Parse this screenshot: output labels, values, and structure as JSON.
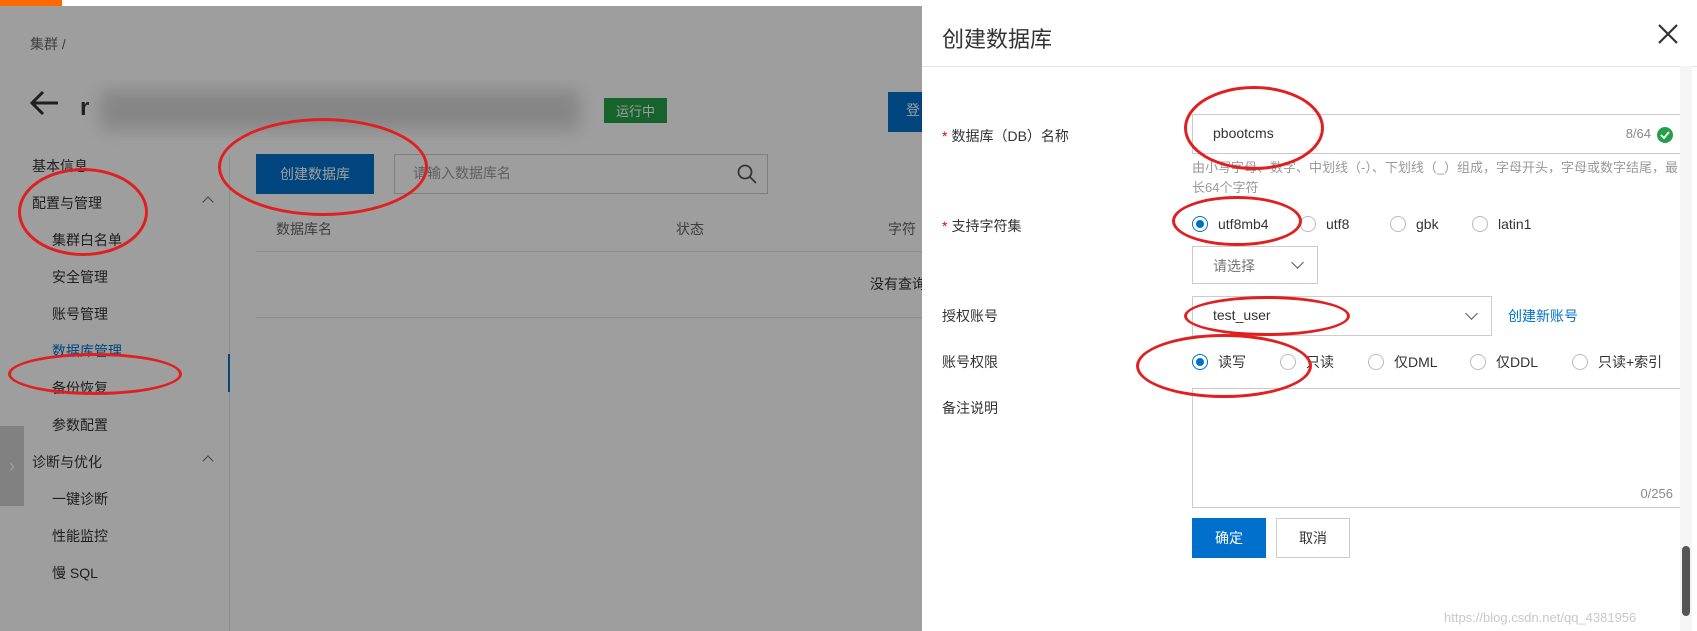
{
  "background": {
    "breadcrumb": "集群  /",
    "cluster_name_visible": "r",
    "status_badge": "运行中",
    "login_button_partial": "登",
    "sidebar": {
      "basic_info": "基本信息",
      "config_group": "配置与管理",
      "config_items": [
        "集群白名单",
        "安全管理",
        "账号管理",
        "数据库管理",
        "备份恢复",
        "参数配置"
      ],
      "diag_group": "诊断与优化",
      "diag_items": [
        "一键诊断",
        "性能监控",
        "慢 SQL"
      ]
    },
    "create_db_button": "创建数据库",
    "search_placeholder": "请输入数据库名",
    "table_headers": [
      "数据库名",
      "状态",
      "字符"
    ],
    "empty_text": "没有查询"
  },
  "drawer": {
    "title": "创建数据库",
    "db_name": {
      "label": "数据库（DB）名称",
      "value": "pbootcms",
      "count": "8/64",
      "hint": "由小写字母、数字、中划线（-）、下划线（_）组成，字母开头，字母或数字结尾，最长64个字符"
    },
    "charset": {
      "label": "支持字符集",
      "options": [
        "utf8mb4",
        "utf8",
        "gbk",
        "latin1"
      ],
      "selected": "utf8mb4",
      "select_placeholder": "请选择"
    },
    "account": {
      "label": "授权账号",
      "value": "test_user",
      "create_link": "创建新账号"
    },
    "permission": {
      "label": "账号权限",
      "options": [
        "读写",
        "只读",
        "仅DML",
        "仅DDL",
        "只读+索引"
      ],
      "selected": "读写"
    },
    "remark": {
      "label": "备注说明",
      "value": "",
      "count": "0/256"
    },
    "ok_button": "确定",
    "cancel_button": "取消"
  },
  "watermark": "https://blog.csdn.net/qq_4381956",
  "colors": {
    "accent": "#0070cc",
    "running": "#24a148",
    "annotation": "#e02020",
    "required": "#e00000"
  }
}
